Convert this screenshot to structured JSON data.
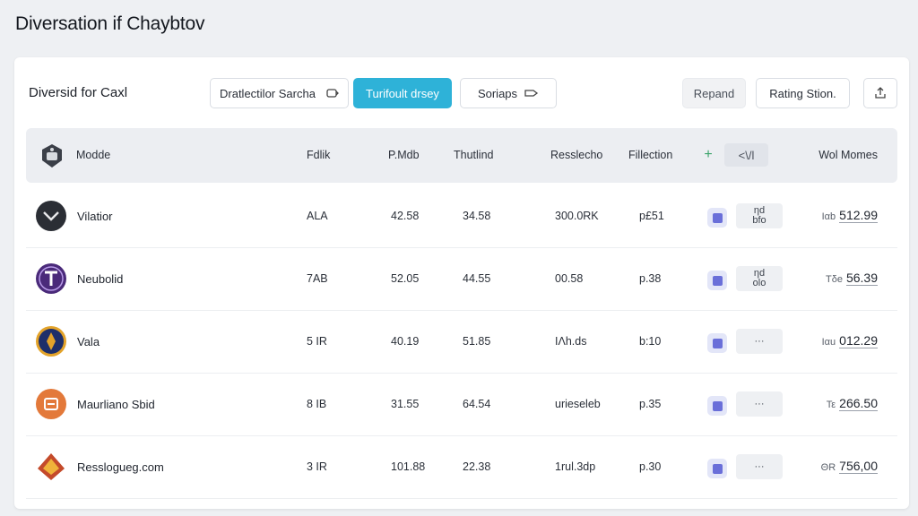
{
  "app": {
    "title": "Diversation if Chaybtov"
  },
  "toolbar": {
    "title": "Diversid for Caxl",
    "search_label": "Dratlectilor Sarcha",
    "primary_label": "Turifoult drsey",
    "sort_label": "Soriaps",
    "gray_label": "Repand",
    "rating_label": "Rating Stion.",
    "share_icon": "share-icon"
  },
  "table": {
    "headers": {
      "name": "Modde",
      "c1": "Fdlik",
      "c2": "P.Mdb",
      "c3": "Thutlind",
      "c4": "Resslecho",
      "c5": "Fillection",
      "plus": "+",
      "code": "<\\/l",
      "price": "Wol Momes"
    },
    "rows": [
      {
        "name": "Vilatior",
        "c1": "ALA",
        "c2": "42.58",
        "c3": "34.58",
        "c4": "300.0RK",
        "c5": "p£51",
        "more": "ηd\nbfo",
        "price_prefix": "Ιαb",
        "price": "512.99",
        "logo_color": "#2b2e35",
        "logo_accent": "#e8e8ea"
      },
      {
        "name": "Neubolid",
        "c1": "7AB",
        "c2": "52.05",
        "c3": "44.55",
        "c4": "00.58",
        "c5": "p.38",
        "more": "ηd\nolo",
        "price_prefix": "Τδe",
        "price": "56.39",
        "logo_color": "#4a2a7a",
        "logo_accent": "#ffffff"
      },
      {
        "name": "Vala",
        "c1": "5 IR",
        "c2": "40.19",
        "c3": "51.85",
        "c4": "ΙΛh.ds",
        "c5": "b:10",
        "more": "···",
        "price_prefix": "Ιαu",
        "price": "012.29",
        "logo_color": "#1e2f6a",
        "logo_accent": "#e3a32a"
      },
      {
        "name": "Maurliano Sbid",
        "c1": "8 IB",
        "c2": "31.55",
        "c3": "64.54",
        "c4": "urieseleb",
        "c5": "p.35",
        "more": "···",
        "price_prefix": "Τε",
        "price": "266.50",
        "logo_color": "#e3793a",
        "logo_accent": "#ffffff"
      },
      {
        "name": "Resslogueg.com",
        "c1": "3 IR",
        "c2": "101.88",
        "c3": "22.38",
        "c4": "1rul.3dp",
        "c5": "p.30",
        "more": "···",
        "price_prefix": "ΘR",
        "price": "756,00",
        "logo_color": "#c44a2a",
        "logo_accent": "#f0b23a"
      }
    ]
  }
}
